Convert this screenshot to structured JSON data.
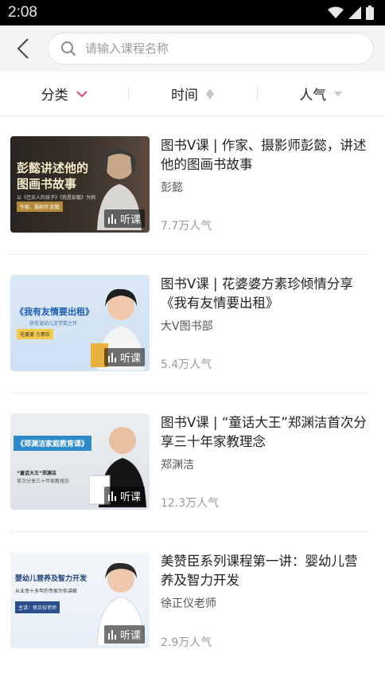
{
  "status": {
    "time": "2:08"
  },
  "search": {
    "placeholder": "请输入课程名称"
  },
  "filters": [
    {
      "label": "分类"
    },
    {
      "label": "时间"
    },
    {
      "label": "人气"
    }
  ],
  "courses": [
    {
      "title": "图书V课 | 作家、摄影师彭懿，讲述他的图画书故事",
      "author": "彭懿",
      "popularity": "7.7万人气",
      "badge": "听课",
      "thumb_title": "彭懿讲述他的图画书故事",
      "thumb_sub": "以《巴夫人的孩子》《我是彭懿》为例",
      "thumb_tag": "作家、摄影师 彭懿"
    },
    {
      "title": "图书V课 | 花婆婆方素珍倾情分享《我有友情要出租》",
      "author": "大V图书部",
      "popularity": "5.4万人气",
      "badge": "听课",
      "thumb_title": "《我有友情要出租》",
      "thumb_sub": "获信谊幼儿文学奖之作",
      "thumb_tag": "花婆婆 方素珍"
    },
    {
      "title": "图书V课 | “童话大王”郑渊洁首次分享三十年家教理念",
      "author": "郑渊洁",
      "popularity": "12.3万人气",
      "badge": "听课",
      "thumb_title": "《郑渊洁家庭教育课》",
      "thumb_sub": "“童话大王”郑渊洁",
      "thumb_tag": "首次分享三十年家教理念"
    },
    {
      "title": "美赞臣系列课程第一讲：婴幼儿营养及智力开发",
      "author": "徐正仪老师",
      "popularity": "2.9万人气",
      "badge": "听课",
      "thumb_title": "婴幼儿营养及智力开发",
      "thumb_sub": "从业资十多年的专家为你讲解",
      "thumb_tag": "主讲：徐正仪老师"
    }
  ],
  "colors": {
    "accent": "#e8457a",
    "muted": "#c8c8c8"
  }
}
